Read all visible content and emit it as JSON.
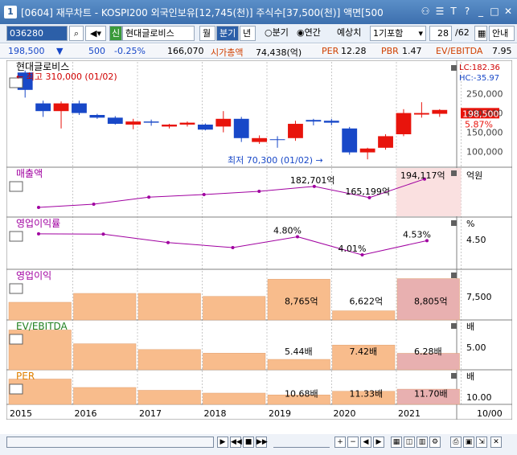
{
  "window": {
    "title": "[0604] 재무차트 - KOSPI200 외국인보유[12,745(천)] 주식수[37,500(천)] 액면[500"
  },
  "toolbar": {
    "code": "036280",
    "badge": "신",
    "company": "현대글로비스",
    "period_month": "월",
    "period_quarter": "분기",
    "period_year": "년",
    "radio_quarter": "분기",
    "radio_cumulative": "연간",
    "estimate_label": "예상치",
    "estimate_value": "1기포함",
    "page": "28",
    "page_total": "/62",
    "guide": "안내"
  },
  "info": {
    "price": "198,500",
    "change": "500",
    "change_pct": "-0.25%",
    "volume": "166,070",
    "mcap_label": "시가총액",
    "mcap_value": "74,438(억)",
    "per_label": "PER",
    "per_value": "12.28",
    "pbr_label": "PBR",
    "pbr_value": "1.47",
    "ev_label": "EV/EBITDA",
    "ev_value": "7.95"
  },
  "chart_data": {
    "type": "candlestick_composite",
    "price_panel": {
      "name": "현대글로비스",
      "lc": "LC:182.36",
      "hc": "HC:-35.97",
      "high_label": "최고 310,000 (01/02)",
      "low_label": "최저 70,300 (01/02)",
      "current_price": "198,500",
      "current_pct": "5.87%",
      "y_ticks": [
        "250,000",
        "200,000",
        "150,000",
        "100,000"
      ],
      "ylim": [
        70000,
        320000
      ],
      "candles": [
        {
          "o": 260000,
          "h": 310000,
          "l": 240000,
          "c": 305000,
          "up": false
        },
        {
          "o": 225000,
          "h": 232000,
          "l": 190000,
          "c": 205000,
          "up": false
        },
        {
          "o": 205000,
          "h": 230000,
          "l": 160000,
          "c": 225000,
          "up": true
        },
        {
          "o": 225000,
          "h": 232000,
          "l": 195000,
          "c": 200000,
          "up": false
        },
        {
          "o": 195000,
          "h": 198000,
          "l": 185000,
          "c": 188000,
          "up": false
        },
        {
          "o": 188000,
          "h": 192000,
          "l": 170000,
          "c": 172000,
          "up": false
        },
        {
          "o": 170000,
          "h": 185000,
          "l": 158000,
          "c": 178000,
          "up": true
        },
        {
          "o": 178000,
          "h": 183000,
          "l": 167000,
          "c": 175000,
          "up": false
        },
        {
          "o": 165000,
          "h": 172000,
          "l": 160000,
          "c": 170000,
          "up": true
        },
        {
          "o": 170000,
          "h": 178000,
          "l": 165000,
          "c": 175000,
          "up": true
        },
        {
          "o": 170000,
          "h": 173000,
          "l": 155000,
          "c": 157000,
          "up": false
        },
        {
          "o": 165000,
          "h": 205000,
          "l": 150000,
          "c": 185000,
          "up": true
        },
        {
          "o": 185000,
          "h": 190000,
          "l": 125000,
          "c": 135000,
          "up": false
        },
        {
          "o": 135000,
          "h": 142000,
          "l": 120000,
          "c": 125000,
          "up": true
        },
        {
          "o": 130000,
          "h": 140000,
          "l": 110000,
          "c": 132000,
          "up": false
        },
        {
          "o": 135000,
          "h": 180000,
          "l": 128000,
          "c": 172000,
          "up": true
        },
        {
          "o": 178000,
          "h": 185000,
          "l": 168000,
          "c": 182000,
          "up": false
        },
        {
          "o": 180000,
          "h": 185000,
          "l": 168000,
          "c": 175000,
          "up": false
        },
        {
          "o": 160000,
          "h": 164000,
          "l": 92000,
          "c": 98000,
          "up": false
        },
        {
          "o": 98000,
          "h": 110000,
          "l": 80000,
          "c": 108000,
          "up": true
        },
        {
          "o": 110000,
          "h": 145000,
          "l": 105000,
          "c": 140000,
          "up": true
        },
        {
          "o": 145000,
          "h": 210000,
          "l": 140000,
          "c": 200000,
          "up": true
        },
        {
          "o": 196000,
          "h": 228000,
          "l": 188000,
          "c": 200000,
          "up": true
        },
        {
          "o": 198000,
          "h": 210000,
          "l": 190000,
          "c": 208000,
          "up": true
        }
      ]
    },
    "sales_panel": {
      "name": "매출액",
      "unit": "억원",
      "values": [
        150000,
        155000,
        166000,
        170000,
        175000,
        182701,
        165199,
        194117
      ],
      "labels": [
        "",
        "",
        "",
        "",
        "",
        "182,701억",
        "165,199억",
        "194,117억"
      ],
      "ylim": [
        145000,
        200000
      ]
    },
    "margin_panel": {
      "name": "영업이익률",
      "unit": "%",
      "y_tick": "4.50",
      "values": [
        5.0,
        4.98,
        4.4,
        4.05,
        4.8,
        3.55,
        4.53
      ],
      "labels": [
        "",
        "",
        "",
        "",
        "4.80%",
        "4.01%",
        "4.53%"
      ],
      "ylim": [
        3.0,
        5.6
      ]
    },
    "op_profit_panel": {
      "name": "영업이익",
      "y_tick": "7,500",
      "values": [
        7200,
        7800,
        7800,
        7600,
        8765,
        6622,
        8805
      ],
      "labels": [
        "",
        "",
        "",
        "",
        "8,765억",
        "6,622억",
        "8,805억"
      ],
      "ylim": [
        6000,
        9000
      ]
    },
    "ev_panel": {
      "name": "EV/EBITDA",
      "unit": "배",
      "y_tick": "5.00",
      "values": [
        9.5,
        7.6,
        6.8,
        6.3,
        5.44,
        7.42,
        6.28
      ],
      "labels": [
        "",
        "",
        "",
        "",
        "5.44배",
        "7.42배",
        "6.28배"
      ],
      "ylim": [
        4.0,
        10.0
      ]
    },
    "per_panel": {
      "name": "PER",
      "unit": "배",
      "y_tick": "10.00",
      "values": [
        13.5,
        12.0,
        11.5,
        11.0,
        10.68,
        11.33,
        11.7
      ],
      "labels": [
        "",
        "",
        "",
        "",
        "10.68배",
        "11.33배",
        "11.70배"
      ],
      "ylim": [
        9.0,
        14.0
      ]
    },
    "x_labels": [
      "2015",
      "2016",
      "2017",
      "2018",
      "2019",
      "2020",
      "2021"
    ],
    "x_right_label": "10/00",
    "colors": {
      "up": "#e8140c",
      "down": "#1848c8",
      "bar": "#f8bc8c",
      "bar_highlight": "#e8b0b0",
      "line": "#a000a0"
    }
  }
}
